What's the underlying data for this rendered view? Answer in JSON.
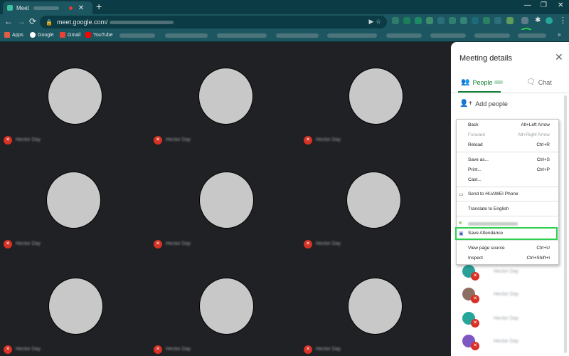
{
  "browser": {
    "tab_title": "Meet",
    "url": "meet.google.com/",
    "bookmarks": [
      "Apps",
      "Google",
      "Gmail",
      "YouTube"
    ]
  },
  "meet": {
    "participants": [
      {
        "name": "Hector Day"
      },
      {
        "name": "Hector Day"
      },
      {
        "name": "Hector Day"
      },
      {
        "name": "Hector Day"
      },
      {
        "name": "Hector Day"
      },
      {
        "name": "Hector Day"
      },
      {
        "name": "Hector Day"
      },
      {
        "name": "Hector Day"
      },
      {
        "name": "Hector Day"
      }
    ],
    "colors": {
      "background": "#202124",
      "avatar": "#c8c8c8",
      "mic_off": "#d93025"
    }
  },
  "panel": {
    "title": "Meeting details",
    "tabs": {
      "people": "People",
      "chat": "Chat"
    },
    "add_people": "Add people",
    "people": [
      {
        "name": "Hector Day",
        "color": "#2aa198"
      },
      {
        "name": "Hector Day",
        "color": "#8d6e63"
      },
      {
        "name": "Hector Day",
        "color": "#26a69a"
      },
      {
        "name": "Hector Day",
        "color": "#7e57c2"
      }
    ],
    "accent": "#188038"
  },
  "context_menu": {
    "items": [
      {
        "label": "Back",
        "shortcut": "Alt+Left Arrow"
      },
      {
        "label": "Forward",
        "shortcut": "Alt+Right Arrow",
        "disabled": true
      },
      {
        "label": "Reload",
        "shortcut": "Ctrl+R"
      },
      {
        "label": "Save as...",
        "shortcut": "Ctrl+S"
      },
      {
        "label": "Print...",
        "shortcut": "Ctrl+P"
      },
      {
        "label": "Cast..."
      },
      {
        "label": "Send to HUAWEI Phone"
      },
      {
        "label": "Translate to English"
      },
      {
        "label": "Save Attendance",
        "highlight_color": "#2ad04e"
      },
      {
        "label": "View page source",
        "shortcut": "Ctrl+U"
      },
      {
        "label": "Inspect",
        "shortcut": "Ctrl+Shift+I"
      }
    ]
  }
}
